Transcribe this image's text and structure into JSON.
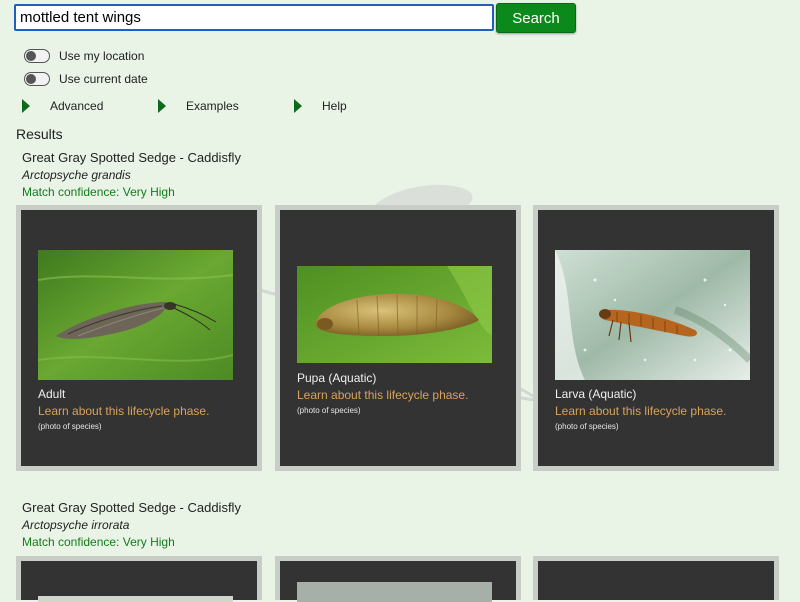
{
  "search": {
    "value": "mottled tent wings",
    "button_label": "Search"
  },
  "toggles": [
    {
      "label": "Use my location",
      "on": false
    },
    {
      "label": "Use current date",
      "on": false
    }
  ],
  "expanders": [
    {
      "label": "Advanced"
    },
    {
      "label": "Examples"
    },
    {
      "label": "Help"
    }
  ],
  "results_heading": "Results",
  "results": [
    {
      "common_name": "Great Gray Spotted Sedge - Caddisfly",
      "scientific_name": "Arctopsyche grandis",
      "confidence": "Match confidence: Very High",
      "cards": [
        {
          "phase": "Adult",
          "link": "Learn about this lifecycle phase.",
          "note": "(photo of species)"
        },
        {
          "phase": "Pupa (Aquatic)",
          "link": "Learn about this lifecycle phase.",
          "note": "(photo of species)"
        },
        {
          "phase": "Larva (Aquatic)",
          "link": "Learn about this lifecycle phase.",
          "note": "(photo of species)"
        }
      ]
    },
    {
      "common_name": "Great Gray Spotted Sedge - Caddisfly",
      "scientific_name": "Arctopsyche irrorata",
      "confidence": "Match confidence: Very High",
      "cards": [
        {},
        {},
        {}
      ]
    }
  ],
  "colors": {
    "background": "#e9f3e6",
    "accent_green": "#0b8a1b",
    "card_bg": "#333333",
    "card_border": "#c9cdc8",
    "link": "#d9a35a",
    "confidence": "#127d1c"
  }
}
